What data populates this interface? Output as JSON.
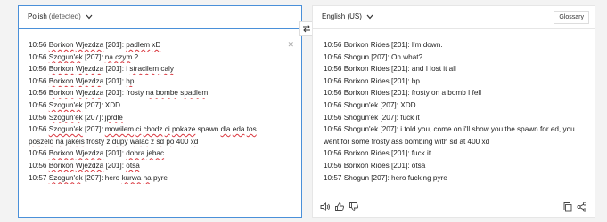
{
  "source": {
    "lang": "Polish",
    "detected": "(detected)",
    "lines": [
      [
        "10:56 ",
        {
          "t": "Borixon",
          "sq": true
        },
        " ",
        {
          "t": "Wjezdza",
          "sq": true
        },
        " [201]: ",
        {
          "t": "padlem",
          "sq": true
        },
        " ",
        {
          "t": "xD",
          "sq": true
        }
      ],
      [
        "10:56 ",
        {
          "t": "Szogun'ek",
          "sq": true
        },
        " [207]: ",
        {
          "t": "na czym",
          "sq": true
        },
        " ?"
      ],
      [
        "10:56 ",
        {
          "t": "Borixon",
          "sq": true
        },
        " ",
        {
          "t": "Wjezdza",
          "sq": true
        },
        " [201]: i ",
        {
          "t": "stracilem",
          "sq": true
        },
        " ",
        {
          "t": "caly",
          "sq": true
        }
      ],
      [
        "10:56 ",
        {
          "t": "Borixon",
          "sq": true
        },
        " ",
        {
          "t": "Wjezdza",
          "sq": true
        },
        " [201]: ",
        {
          "t": "bp",
          "sq": true
        }
      ],
      [
        "10:56 ",
        {
          "t": "Borixon",
          "sq": true
        },
        " ",
        {
          "t": "Wjezdza",
          "sq": true
        },
        " [201]: frosty ",
        {
          "t": "na bombe",
          "sq": true
        },
        " ",
        {
          "t": "spadlem",
          "sq": true
        }
      ],
      [
        "10:56 ",
        {
          "t": "Szogun'ek",
          "sq": true
        },
        " [207]: XDD"
      ],
      [
        "10:56 ",
        {
          "t": "Szogun'ek",
          "sq": true
        },
        " [207]: ",
        {
          "t": "jprdle",
          "sq": true
        }
      ],
      [
        "10:56 ",
        {
          "t": "Szogun'ek",
          "sq": true
        },
        " [207]: ",
        {
          "t": "mowilem",
          "sq": true
        },
        " ",
        {
          "t": "ci",
          "sq": true
        },
        " ",
        {
          "t": "chodz",
          "sq": true
        },
        " ",
        {
          "t": "ci",
          "sq": true
        },
        " ",
        {
          "t": "pokaze",
          "sq": true
        },
        " spawn ",
        {
          "t": "dla",
          "sq": true
        },
        " ",
        {
          "t": "eda",
          "sq": true
        },
        " ",
        {
          "t": "tos",
          "sq": true
        },
        " ",
        {
          "t": "poszeld",
          "sq": true
        },
        " ",
        {
          "t": "na",
          "sq": true
        },
        " ",
        {
          "t": "jakeis",
          "sq": true
        },
        " frosty z ",
        {
          "t": "dupy",
          "sq": true
        },
        " ",
        {
          "t": "walac",
          "sq": true
        },
        " z ",
        {
          "t": "sd",
          "sq": true
        },
        " ",
        {
          "t": "po",
          "sq": true
        },
        " 400 ",
        {
          "t": "xd",
          "sq": true
        }
      ],
      [
        "10:56 ",
        {
          "t": "Borixon",
          "sq": true
        },
        " ",
        {
          "t": "Wjezdza",
          "sq": true
        },
        " [201]: ",
        {
          "t": "dobra",
          "sq": true
        },
        " ",
        {
          "t": "jebac",
          "sq": true
        }
      ],
      [
        "10:56 ",
        {
          "t": "Borixon",
          "sq": true
        },
        " ",
        {
          "t": "Wjezdza",
          "sq": true
        },
        " [201]: ",
        {
          "t": "otsa",
          "sq": true
        }
      ],
      [
        "10:57 ",
        {
          "t": "Szogun'ek",
          "sq": true
        },
        " [207]: hero ",
        {
          "t": "kurwa",
          "sq": true
        },
        " ",
        {
          "t": "na",
          "sq": true
        },
        " pyre"
      ]
    ]
  },
  "target": {
    "lang": "English (US)",
    "glossary": "Glossary",
    "lines": [
      "10:56 Borixon Rides [201]: I'm down.",
      "10:56 Shogun [207]: On what?",
      "10:56 Borixon Rides [201]: and I lost it all",
      "10:56 Borixon Rides [201]: bp",
      "10:56 Borixon Rides [201]: frosty on a bomb I fell",
      "10:56 Shogun'ek [207]: XDD",
      "10:56 Shogun'ek [207]: fuck it",
      "10:56 Shogun'ek [207]: i told you, come on i'll show you the spawn for ed, you went for some frosty ass bombing with sd at 400 xd",
      "10:56 Borixon Rides [201]: fuck it",
      "10:56 Borixon Rides [201]: otsa",
      "10:57 Shogun [207]: hero fucking pyre"
    ]
  },
  "icons": {
    "close": "close-icon",
    "swap": "swap-icon",
    "speaker": "speaker-icon",
    "thumbs_up": "thumbs-up-icon",
    "thumbs_down": "thumbs-down-icon",
    "copy": "copy-icon",
    "share": "share-icon"
  },
  "colors": {
    "accent": "#4a90d9",
    "spell_error": "#d9363e"
  }
}
